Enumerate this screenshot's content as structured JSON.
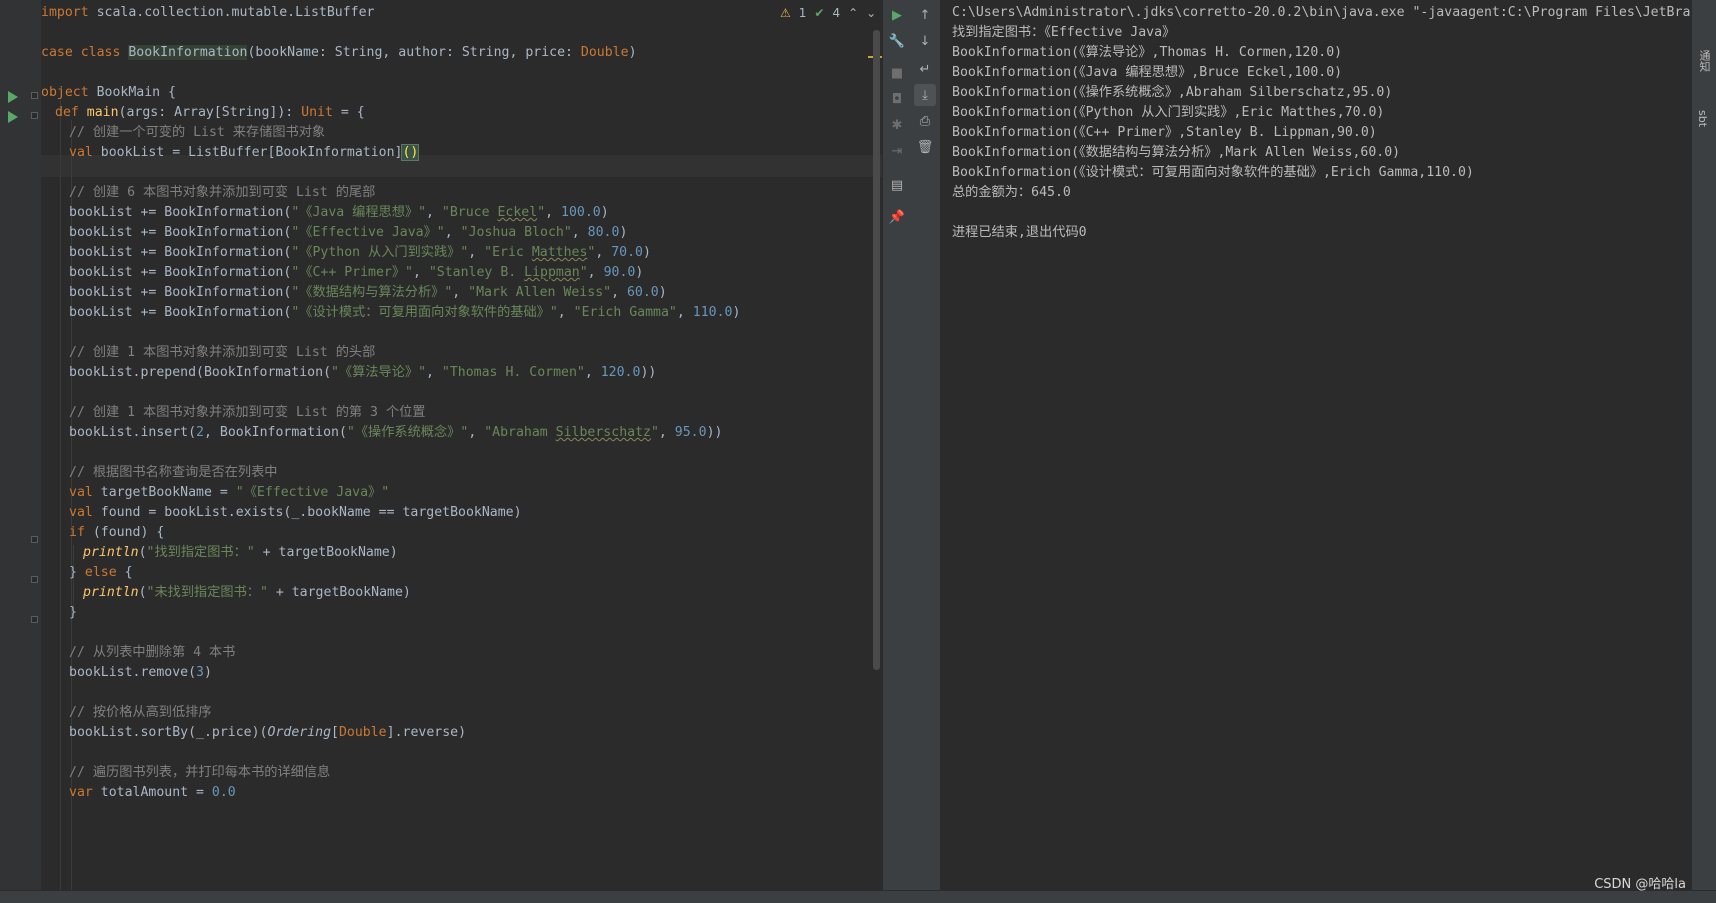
{
  "inspections": {
    "warnings": "1",
    "checks": "4"
  },
  "code": {
    "l1": {
      "kw": "import",
      "rest": " scala.collection.mutable.ListBuffer"
    },
    "l2": {
      "kw": "case class",
      "name": "BookInformation",
      "a": "(bookName: String, author: String, price: ",
      "type": "Double",
      "b": ")"
    },
    "l3": {
      "kw": "object",
      "rest": " BookMain {"
    },
    "l4": {
      "kw": "def",
      "fn": "main",
      "a": "(args: Array[String]): ",
      "type": "Unit",
      "b": " = {"
    },
    "l5": {
      "cmt": "// 创建一个可变的 List 来存储图书对象"
    },
    "l6": {
      "kw": "val",
      "a": " bookList = ListBuffer[BookInformation]",
      "b": "()"
    },
    "l7": {
      "cmt": "// 创建 6 本图书对象并添加到可变 List 的尾部"
    },
    "l8": {
      "a": "bookList += BookInformation(",
      "s1": "\"《Java 编程思想》\"",
      "c": ", ",
      "s2a": "\"Bruce ",
      "s2u": "Eckel",
      "s2b": "\"",
      "d": ", ",
      "n": "100.0",
      "e": ")"
    },
    "l9": {
      "a": "bookList += BookInformation(",
      "s1": "\"《Effective Java》\"",
      "c": ", ",
      "s2": "\"Joshua Bloch\"",
      "d": ", ",
      "n": "80.0",
      "e": ")"
    },
    "l10": {
      "a": "bookList += BookInformation(",
      "s1": "\"《Python 从入门到实践》\"",
      "c": ", ",
      "s2a": "\"Eric ",
      "s2u": "Matthes",
      "s2b": "\"",
      "d": ", ",
      "n": "70.0",
      "e": ")"
    },
    "l11": {
      "a": "bookList += BookInformation(",
      "s1": "\"《C++ Primer》\"",
      "c": ", ",
      "s2a": "\"Stanley B. ",
      "s2u": "Lippman",
      "s2b": "\"",
      "d": ", ",
      "n": "90.0",
      "e": ")"
    },
    "l12": {
      "a": "bookList += BookInformation(",
      "s1": "\"《数据结构与算法分析》\"",
      "c": ", ",
      "s2": "\"Mark Allen Weiss\"",
      "d": ", ",
      "n": "60.0",
      "e": ")"
    },
    "l13": {
      "a": "bookList += BookInformation(",
      "s1": "\"《设计模式：可复用面向对象软件的基础》\"",
      "c": ", ",
      "s2": "\"Erich Gamma\"",
      "d": ", ",
      "n": "110.0",
      "e": ")"
    },
    "l14": {
      "cmt": "// 创建 1 本图书对象并添加到可变 List 的头部"
    },
    "l15": {
      "a": "bookList.prepend(BookInformation(",
      "s1": "\"《算法导论》\"",
      "c": ", ",
      "s2": "\"Thomas H. Cormen\"",
      "d": ", ",
      "n": "120.0",
      "e": "))"
    },
    "l16": {
      "cmt": "// 创建 1 本图书对象并添加到可变 List 的第 3 个位置"
    },
    "l17": {
      "a": "bookList.insert(",
      "n0": "2",
      "a2": ", BookInformation(",
      "s1": "\"《操作系统概念》\"",
      "c": ", ",
      "s2a": "\"Abraham ",
      "s2u": "Silberschatz",
      "s2b": "\"",
      "d": ", ",
      "n": "95.0",
      "e": "))"
    },
    "l18": {
      "cmt": "// 根据图书名称查询是否在列表中"
    },
    "l19": {
      "kw": "val",
      "a": " targetBookName = ",
      "s": "\"《Effective Java》\""
    },
    "l20": {
      "kw": "val",
      "a": " found = bookList.exists(_.bookName == targetBookName)"
    },
    "l21": {
      "kw": "if",
      "a": " (found) {"
    },
    "l22": {
      "fn": "println",
      "a": "(",
      "s": "\"找到指定图书：\"",
      "b": " + targetBookName)"
    },
    "l23": {
      "a": "} ",
      "kw": "else",
      "b": " {"
    },
    "l24": {
      "fn": "println",
      "a": "(",
      "s": "\"未找到指定图书：\"",
      "b": " + targetBookName)"
    },
    "l25": {
      "a": "}"
    },
    "l26": {
      "cmt": "// 从列表中删除第 4 本书"
    },
    "l27": {
      "a": "bookList.remove(",
      "n": "3",
      "b": ")"
    },
    "l28": {
      "cmt": "// 按价格从高到低排序"
    },
    "l29": {
      "a": "bookList.sortBy(_.price)(",
      "it": "Ordering",
      "b": "[",
      "type": "Double",
      "c": "].reverse)"
    },
    "l30": {
      "cmt": "// 遍历图书列表，并打印每本书的详细信息"
    },
    "l31": {
      "kw": "var",
      "a": " totalAmount = ",
      "n": "0.0"
    }
  },
  "console": [
    "C:\\Users\\Administrator\\.jdks\\corretto-20.0.2\\bin\\java.exe \"-javaagent:C:\\Program Files\\JetBra",
    "找到指定图书：《Effective Java》",
    "BookInformation(《算法导论》,Thomas H. Cormen,120.0)",
    "BookInformation(《Java 编程思想》,Bruce Eckel,100.0)",
    "BookInformation(《操作系统概念》,Abraham Silberschatz,95.0)",
    "BookInformation(《Python 从入门到实践》,Eric Matthes,70.0)",
    "BookInformation(《C++ Primer》,Stanley B. Lippman,90.0)",
    "BookInformation(《数据结构与算法分析》,Mark Allen Weiss,60.0)",
    "BookInformation(《设计模式：可复用面向对象软件的基础》,Erich Gamma,110.0)",
    "总的金额为：645.0",
    "",
    "进程已结束,退出代码0"
  ],
  "side_labels": {
    "notifications": "通知",
    "sbt": "sbt"
  },
  "watermark": "CSDN @哈哈la",
  "icons": {
    "run": "play-icon",
    "up": "arrow-up-icon",
    "down": "arrow-down-icon",
    "wrap": "soft-wrap-icon",
    "scroll": "scroll-to-end-icon",
    "print": "print-icon",
    "trash": "trash-icon",
    "wrench": "wrench-icon",
    "stop": "stop-icon",
    "camera": "camera-icon",
    "bug": "debug-icon",
    "exit": "exit-icon",
    "layout": "layout-icon",
    "pin": "pin-icon"
  }
}
